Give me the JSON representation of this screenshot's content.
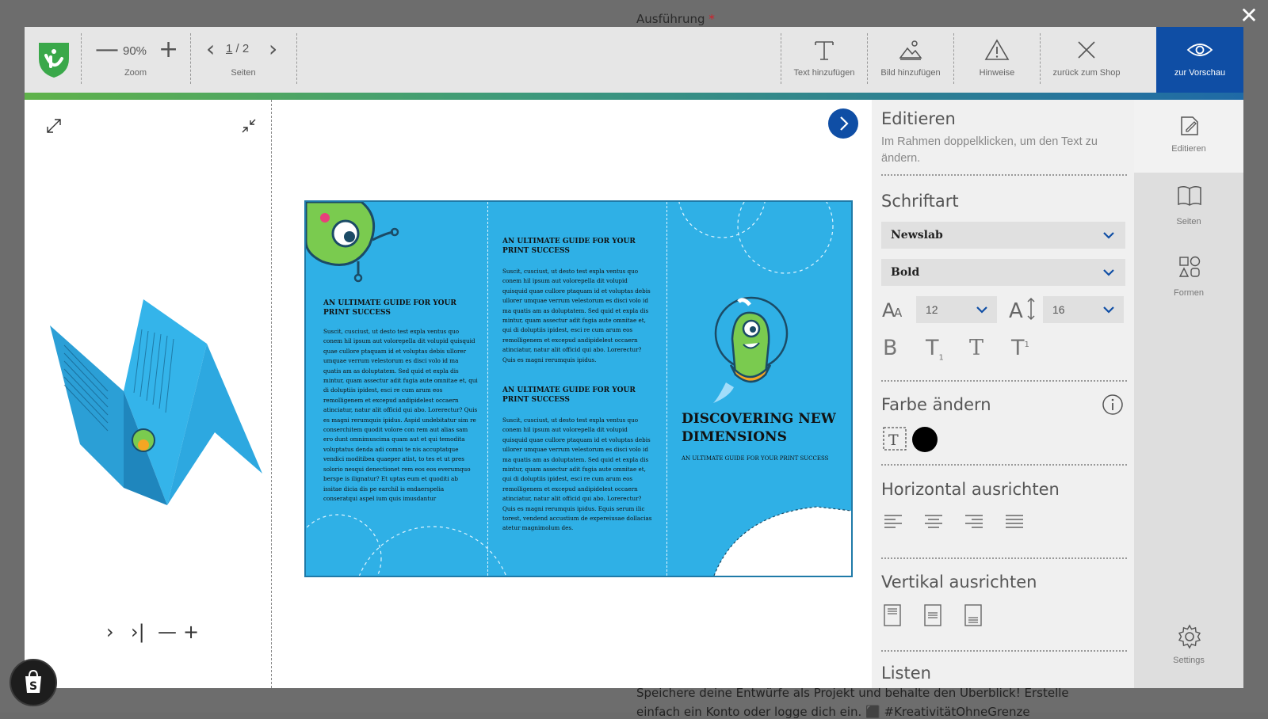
{
  "background": {
    "top_label": "Ausführung",
    "top_required": "*",
    "bottom_line1": "Speichere deine Entwürfe als Projekt und behalte den Überblick! Erstelle",
    "bottom_line2": "einfach ein Konto oder logge dich ein. ⬛️ #KreativitätOhneGrenze"
  },
  "close": "✕",
  "toolbar": {
    "zoom_minus": "—",
    "zoom_value": "90%",
    "zoom_plus": "+",
    "zoom_label": "Zoom",
    "page_prev": "‹",
    "page_current": "1",
    "page_sep": " / ",
    "page_total": "2",
    "page_next": "›",
    "pages_label": "Seiten",
    "add_text": "Text hinzufügen",
    "add_image": "Bild hinzufügen",
    "hints": "Hinweise",
    "back_to_shop": "zurück zum Shop",
    "to_preview": "zur Vorschau",
    "accent": "#0f4ea5"
  },
  "left_panel": {
    "ctrl_next": "›",
    "ctrl_last": "›|",
    "ctrl_minus": "—",
    "ctrl_plus": "+"
  },
  "brochure": {
    "heading": "AN ULTIMATE GUIDE FOR YOUR PRINT SUCCESS",
    "body_long": "Suscit, cusciust, ut desto test expla ventus quo conem hil ipsum aut volorepella dit volupid quisquid quae cullore ptaquam id et voluptas debis ullorer umquae verrum velestorum es disci volo id ma quatis am as doluptatem. Sed quid et expla dis mintur, quam assectur adit fugia aute omnitae et, qui di doluptiis ipidest, esci re cum arum eos remolligenem et excepud andipidelest occaern atinciatur, natur alit officid qui abo. Lorerectur? Quis es magni rerumquis ipidus. Aspid undebitatur sim re conserchitem quodit volore con rem aut alias sam ero dunt omnimuscima quam aut et qui temodita voluptatus denda adi comni te nis accuptatque vendici moditibea quaeper atist, to tes et ut pres solorio nesqui denectionet rem eos eos everumquo berspe is ilignatur? Et uptas eum et quoditi ab issitae dicia dis pe earchil is endaerspelia conseratqui aspel ium quis imusdantur",
    "body_mid1": "Suscit, cusciust, ut desto test expla ventus quo conem hil ipsum aut volorepella dit volupid quisquid quae cullore ptaquam id et voluptas debis ullorer umquae verrum velestorum es disci volo id ma quatis am as doluptatem. Sed quid et expla dis mintur, quam assectur adit fugia aute omnitae et, qui di doluptiis ipidest, esci re cum arum eos remolligenem et excepud andipidelest occaern atinciatur, natur alit officid qui abo. Lorerectur? Quis es magni rerumquis ipidus.",
    "body_mid2": "Suscit, cusciust, ut desto test expla ventus quo conem hil ipsum aut volorepella dit volupid quisquid quae cullore ptaquam id et voluptas debis ullorer umquae verrum velestorum es disci volo id ma quatis am as doluptatem. Sed quid et expla dis mintur, quam assectur adit fugia aute omnitae et, qui di doluptiis ipidest, esci re cum arum eos remolligenem et excepud andipidelest occaern atinciatur, natur alit officid qui abo. Lorerectur? Quis es magni rerumquis ipidus. Equis serum ilic torest, vendend accustium de expereiusae dollacias atetur magnimolum des.",
    "title": "DISCOVERING NEW DIMENSIONS",
    "subtitle": "AN ULTIMATE GUIDE FOR YOUR PRINT SUCCESS",
    "color": "#2fb0e6"
  },
  "panel": {
    "edit_title": "Editieren",
    "edit_help": "Im Rahmen doppelklicken, um den Text zu ändern.",
    "font_title": "Schriftart",
    "font_family": "Newslab",
    "font_style": "Bold",
    "font_size": "12",
    "line_height": "16",
    "fmt_bold": "B",
    "fmt_sub": "T",
    "fmt_normal": "T",
    "fmt_sup": "T",
    "color_title": "Farbe ändern",
    "current_color": "#000000",
    "halign_title": "Horizontal ausrichten",
    "valign_title": "Vertikal ausrichten",
    "lists_title": "Listen"
  },
  "rail": {
    "edit": "Editieren",
    "pages": "Seiten",
    "shapes": "Formen",
    "settings": "Settings"
  }
}
